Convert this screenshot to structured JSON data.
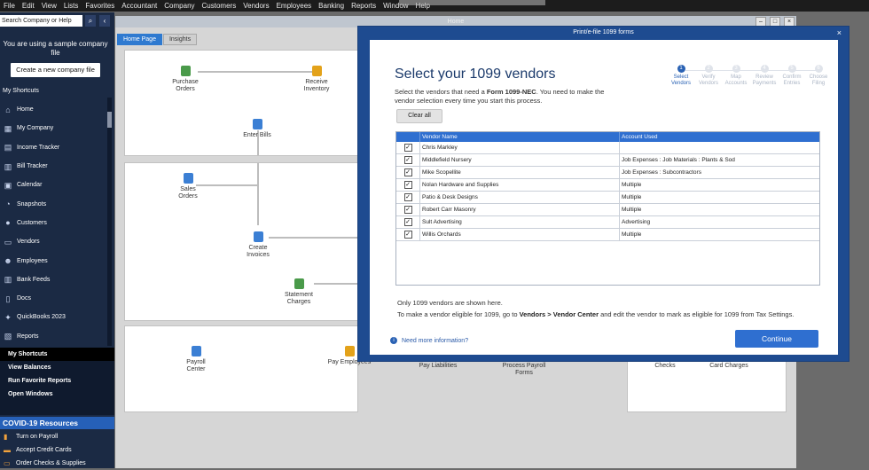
{
  "menubar": {
    "items": [
      "File",
      "Edit",
      "View",
      "Lists",
      "Favorites",
      "Accountant",
      "Company",
      "Customers",
      "Vendors",
      "Employees",
      "Banking",
      "Reports",
      "Window",
      "Help"
    ]
  },
  "sidebar": {
    "search_placeholder": "Search Company or Help",
    "sample_text": "You are using a sample company file",
    "create_button": "Create a new company file",
    "my_shortcuts_heading": "My Shortcuts",
    "items": [
      {
        "label": "Home",
        "icon": "home-icon"
      },
      {
        "label": "My Company",
        "icon": "company-icon"
      },
      {
        "label": "Income Tracker",
        "icon": "income-icon"
      },
      {
        "label": "Bill Tracker",
        "icon": "bill-icon"
      },
      {
        "label": "Calendar",
        "icon": "calendar-icon"
      },
      {
        "label": "Snapshots",
        "icon": "snapshot-icon"
      },
      {
        "label": "Customers",
        "icon": "customers-icon"
      },
      {
        "label": "Vendors",
        "icon": "vendors-icon"
      },
      {
        "label": "Employees",
        "icon": "employees-icon"
      },
      {
        "label": "Bank Feeds",
        "icon": "bank-icon"
      },
      {
        "label": "Docs",
        "icon": "docs-icon"
      },
      {
        "label": "QuickBooks 2023",
        "icon": "quickbooks-icon"
      },
      {
        "label": "Reports",
        "icon": "reports-icon"
      }
    ],
    "lower": [
      "My Shortcuts",
      "View Balances",
      "Run Favorite Reports",
      "Open Windows"
    ],
    "covid_heading": "COVID-19 Resources",
    "covid_items": [
      "Turn on Payroll",
      "Accept Credit Cards",
      "Order Checks & Supplies"
    ]
  },
  "home": {
    "title": "Home",
    "tabs": [
      "Home Page",
      "Insights"
    ],
    "nodes": {
      "purchase_orders": "Purchase Orders",
      "receive_inventory": "Receive Inventory",
      "enter_bills": "Enter Bills",
      "sales_orders": "Sales Orders",
      "create_invoices": "Create Invoices",
      "statement_charges": "Statement Charges",
      "payroll_center": "Payroll Center",
      "pay_employees": "Pay Employees",
      "pay_liabilities": "Pay Liabilities",
      "process_payroll_forms": "Process Payroll Forms",
      "checks": "Checks",
      "card_charges": "Card Charges"
    }
  },
  "dialog": {
    "title": "Print/e-file 1099 forms",
    "heading": "Select your 1099 vendors",
    "desc_pre": "Select the vendors that need a ",
    "desc_bold": "Form 1099-NEC",
    "desc_post": ". You need to make the vendor selection every time you start this process.",
    "clear_all": "Clear all",
    "steps": [
      {
        "num": "1",
        "label": "Select Vendors",
        "active": true
      },
      {
        "num": "2",
        "label": "Verify Vendors",
        "active": false
      },
      {
        "num": "3",
        "label": "Map Accounts",
        "active": false
      },
      {
        "num": "4",
        "label": "Review Payments",
        "active": false
      },
      {
        "num": "5",
        "label": "Confirm Entries",
        "active": false
      },
      {
        "num": "6",
        "label": "Choose Filing",
        "active": false
      }
    ],
    "columns": [
      "Vendor Name",
      "Account Used"
    ],
    "rows": [
      {
        "name": "Chris Markley",
        "account": ""
      },
      {
        "name": "Middlefield Nursery",
        "account": "Job Expenses : Job Materials : Plants & Sod"
      },
      {
        "name": "Mike Scopellite",
        "account": "Job Expenses : Subcontractors"
      },
      {
        "name": "Nolan Hardware and Supplies",
        "account": "Multiple"
      },
      {
        "name": "Patio & Desk Designs",
        "account": "Multiple"
      },
      {
        "name": "Robert Carr Masonry",
        "account": "Multiple"
      },
      {
        "name": "Sult Advertising",
        "account": "Advertising"
      },
      {
        "name": "Willis Orchards",
        "account": "Multiple"
      }
    ],
    "note1": "Only 1099 vendors are shown here.",
    "note2_pre": "To make a vendor eligible for 1099, go to ",
    "note2_bold": "Vendors > Vendor Center",
    "note2_post": " and edit the vendor to mark as eligible for 1099 from Tax Settings.",
    "info_link": "Need more information?",
    "continue": "Continue"
  },
  "colors": {
    "primary": "#2f6fd0",
    "sidebar": "#1b2a44",
    "dialog_frame": "#1e4b90",
    "covid_bar": "#2660b8"
  }
}
